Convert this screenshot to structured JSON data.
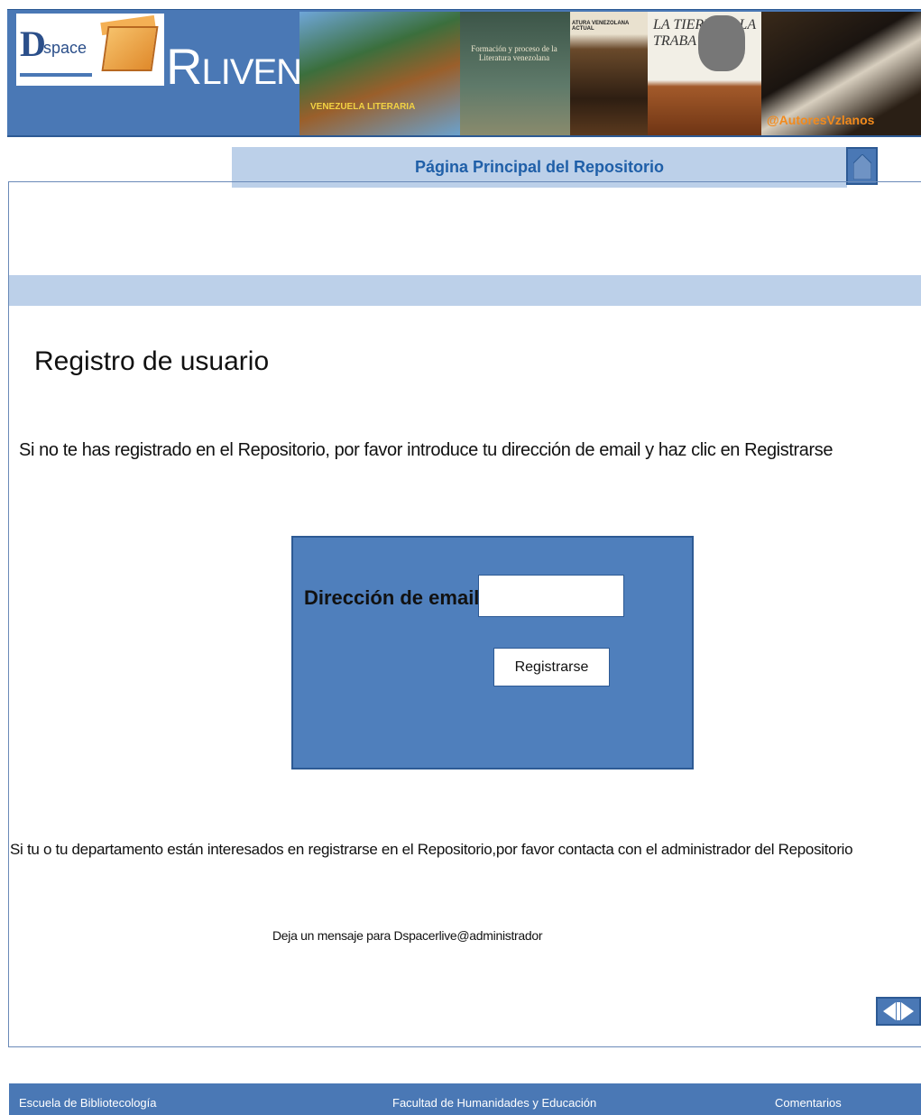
{
  "header": {
    "logo_d": "D",
    "logo_space": "space",
    "title_first": "R",
    "title_rest": "LIVEN",
    "photo1_text": "VENEZUELA LITERARIA",
    "photo2_text": "Formación y proceso de la Literatura venezolana",
    "photo3_text": "ATURA VENEZOLANA ACTUAL",
    "photo4_text": "LA TIERRA ... LA TRABA",
    "photo5_text": "@AutoresVzlanos"
  },
  "nav": {
    "main_link": "Página Principal del Repositorio",
    "home_icon": "home-icon"
  },
  "main": {
    "title": "Registro de usuario",
    "intro": "Si no te has registrado en el Repositorio, por favor introduce tu dirección de email y haz clic en Registrarse",
    "form": {
      "email_label": "Dirección de email",
      "email_value": "",
      "register_label": "Registrarse"
    },
    "dept_text": "Si tu o tu departamento están interesados en registrarse  en el Repositorio,por favor contacta con el  administrador del Repositorio",
    "contact_text": "Deja un mensaje para  Dspacerlive@administrador",
    "pager_icon": "prev-next-icon"
  },
  "footer": {
    "link1": "Escuela de Bibliotecología",
    "link2": "Facultad de Humanidades y Educación",
    "link3": "Comentarios"
  },
  "colors": {
    "header_blue": "#4a78b5",
    "light_blue": "#bcd0e9",
    "form_blue": "#4f7fbc",
    "link_blue": "#1f5fa8"
  }
}
